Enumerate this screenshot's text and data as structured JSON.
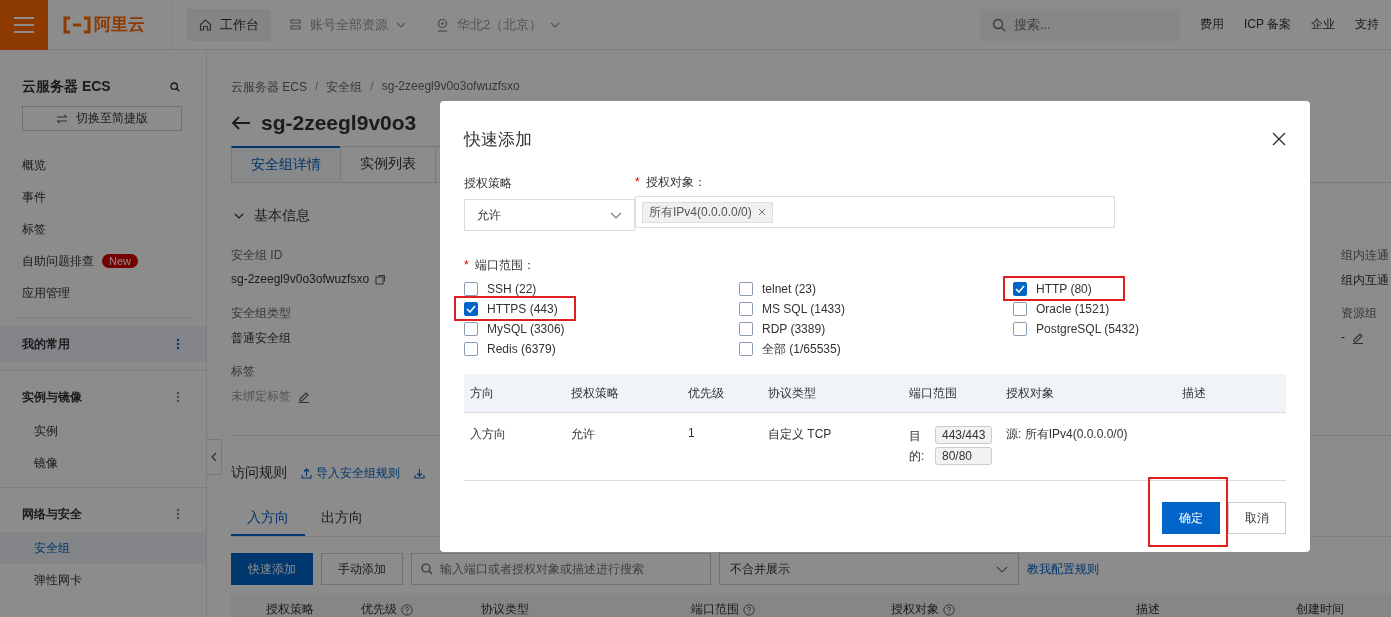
{
  "topbar": {
    "logo": "阿里云",
    "nav": [
      {
        "label": "工作台",
        "kind": "home",
        "selected": true
      },
      {
        "label": "账号全部资源",
        "kind": "resources",
        "selected": false
      },
      {
        "label": "华北2（北京）",
        "kind": "region",
        "selected": false
      }
    ],
    "search": {
      "placeholder": "搜索..."
    },
    "links": [
      "费用",
      "ICP 备案",
      "企业",
      "支持"
    ]
  },
  "sidebar": {
    "title": "云服务器 ECS",
    "switch_button": "切换至简捷版",
    "items": [
      {
        "label": "概览"
      },
      {
        "label": "事件"
      },
      {
        "label": "标签"
      },
      {
        "label": "自助问题排查",
        "badge": "New"
      },
      {
        "label": "应用管理"
      }
    ],
    "groups": [
      {
        "label": "我的常用",
        "selected": true
      },
      {
        "label": "实例与镜像",
        "selected": false,
        "children": [
          {
            "label": "实例",
            "selected": false
          },
          {
            "label": "镜像",
            "selected": false
          }
        ]
      },
      {
        "label": "网络与安全",
        "selected": false,
        "children": [
          {
            "label": "安全组",
            "selected": true
          },
          {
            "label": "弹性网卡",
            "selected": false
          }
        ]
      }
    ]
  },
  "main": {
    "breadcrumb": [
      {
        "label": "云服务器 ECS"
      },
      {
        "separator": "/",
        "label": "安全组"
      },
      {
        "separator": "/",
        "label": "sg-2zeegl9v0o3ofwuzfsxo"
      }
    ],
    "title": "sg-2zeegl9v0o3",
    "tabs": [
      {
        "label": "安全组详情",
        "selected": true
      },
      {
        "label": "实例列表",
        "selected": false
      }
    ],
    "section": "基本信息",
    "fields": [
      {
        "label": "安全组 ID",
        "value": "sg-2zeegl9v0o3ofwuzfsxo",
        "kind": "copy",
        "muted": false
      },
      {
        "label": "安全组类型",
        "value": "普通安全组",
        "kind": "plain",
        "muted": false
      },
      {
        "label": "标签",
        "value": "未绑定标签",
        "kind": "edit",
        "muted": true
      }
    ],
    "side_fields": [
      {
        "label": "组内连通",
        "value": "组内互通",
        "kind": "plain",
        "muted": false
      },
      {
        "label": "资源组",
        "value": "-",
        "kind": "edit",
        "muted": false
      }
    ],
    "rules": {
      "title": "访问规则",
      "import_link": "导入安全组规则",
      "direction_tabs": [
        {
          "label": "入方向",
          "selected": true
        },
        {
          "label": "出方向",
          "selected": false
        }
      ],
      "quick_add": "快速添加",
      "manual_add": "手动添加",
      "search": {
        "placeholder": "输入端口或者授权对象或描述进行搜索"
      },
      "merge_select": "不合并展示",
      "help_link": "教我配置规则",
      "columns": [
        {
          "label": "授权策略",
          "help": false
        },
        {
          "label": "优先级",
          "help": true
        },
        {
          "label": "协议类型",
          "help": false
        },
        {
          "label": "端口范围",
          "help": true
        },
        {
          "label": "授权对象",
          "help": true
        },
        {
          "label": "描述",
          "help": false
        },
        {
          "label": "创建时间",
          "help": false
        }
      ]
    }
  },
  "modal": {
    "title": "快速添加",
    "policy": {
      "label": "授权策略",
      "value": "允许"
    },
    "target": {
      "label": "授权对象：",
      "required_mark": "*",
      "tags": [
        "所有IPv4(0.0.0.0/0)"
      ]
    },
    "ports": {
      "label": "端口范围：",
      "required_mark": "*",
      "options": [
        {
          "label": "SSH (22)",
          "checked": false,
          "highlighted": false
        },
        {
          "label": "telnet (23)",
          "checked": false,
          "highlighted": false
        },
        {
          "label": "HTTP (80)",
          "checked": true,
          "highlighted": true
        },
        {
          "label": "HTTPS (443)",
          "checked": true,
          "highlighted": true
        },
        {
          "label": "MS SQL (1433)",
          "checked": false,
          "highlighted": false
        },
        {
          "label": "Oracle (1521)",
          "checked": false,
          "highlighted": false
        },
        {
          "label": "MySQL (3306)",
          "checked": false,
          "highlighted": false
        },
        {
          "label": "RDP (3389)",
          "checked": false,
          "highlighted": false
        },
        {
          "label": "PostgreSQL (5432)",
          "checked": false,
          "highlighted": false
        },
        {
          "label": "Redis (6379)",
          "checked": false,
          "highlighted": false
        },
        {
          "label": "全部 (1/65535)",
          "checked": false,
          "highlighted": false
        }
      ]
    },
    "columns": [
      "方向",
      "授权策略",
      "优先级",
      "协议类型",
      "端口范围",
      "授权对象",
      "描述"
    ],
    "rows": [
      {
        "direction": "入方向",
        "policy": "允许",
        "priority": "1",
        "protocol": "自定义 TCP",
        "port_label": "目的:",
        "ports": [
          "443/443",
          "80/80"
        ],
        "target": "源: 所有IPv4(0.0.0.0/0)"
      }
    ],
    "buttons": [
      {
        "label": "确定",
        "kind": "primary",
        "highlighted": true
      },
      {
        "label": "取消",
        "kind": "default",
        "highlighted": false
      }
    ]
  }
}
